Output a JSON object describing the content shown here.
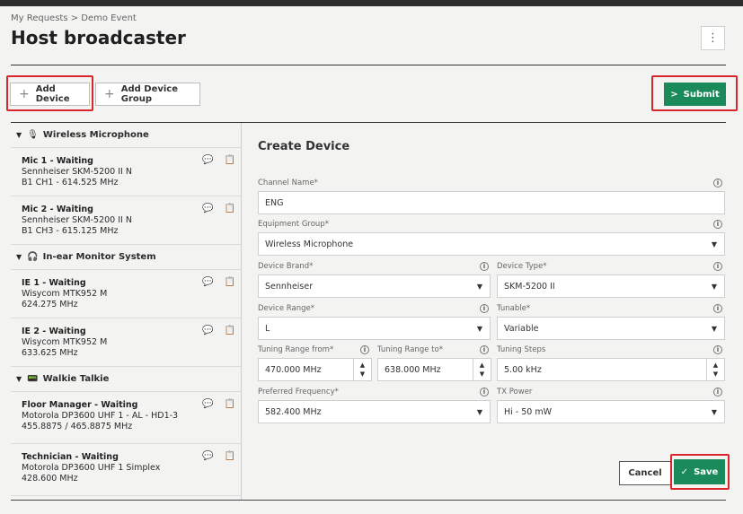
{
  "breadcrumb": "My Requests > Demo Event",
  "page_title": "Host broadcaster",
  "menu_icon": "⋮",
  "toolbar": {
    "add_device": "Add Device",
    "add_device_group": "Add Device Group",
    "submit": "Submit"
  },
  "groups": [
    {
      "label": "Wireless Microphone",
      "icon": "microphone-icon",
      "items": [
        {
          "name": "Mic 1 - Waiting",
          "model": "Sennheiser SKM-5200 II N",
          "freq": "B1 CH1 - 614.525 MHz"
        },
        {
          "name": "Mic 2 - Waiting",
          "model": "Sennheiser SKM-5200 II N",
          "freq": "B1 CH3 - 615.125 MHz"
        }
      ]
    },
    {
      "label": "In-ear Monitor System",
      "icon": "in-ear-icon",
      "items": [
        {
          "name": "IE 1 - Waiting",
          "model": "Wisycom MTK952 M",
          "freq": "624.275 MHz"
        },
        {
          "name": "IE 2 - Waiting",
          "model": "Wisycom MTK952 M",
          "freq": "633.625 MHz"
        }
      ]
    },
    {
      "label": "Walkie Talkie",
      "icon": "walkie-talkie-icon",
      "items": [
        {
          "name": "Floor Manager - Waiting",
          "model": "Motorola DP3600 UHF 1 - AL - HD1-3",
          "freq": "455.8875 / 465.8875 MHz"
        },
        {
          "name": "Technician - Waiting",
          "model": "Motorola DP3600 UHF 1 Simplex",
          "freq": "428.600 MHz"
        }
      ]
    }
  ],
  "form": {
    "title": "Create Device",
    "channel_name": {
      "label": "Channel Name*",
      "value": "ENG"
    },
    "equipment_group": {
      "label": "Equipment Group*",
      "value": "Wireless Microphone"
    },
    "device_brand": {
      "label": "Device Brand*",
      "value": "Sennheiser"
    },
    "device_type": {
      "label": "Device Type*",
      "value": "SKM-5200 II"
    },
    "device_range": {
      "label": "Device Range*",
      "value": "L"
    },
    "tunable": {
      "label": "Tunable*",
      "value": "Variable"
    },
    "tuning_from": {
      "label": "Tuning Range from*",
      "value": "470.000 MHz"
    },
    "tuning_to": {
      "label": "Tuning Range to*",
      "value": "638.000 MHz"
    },
    "tuning_steps": {
      "label": "Tuning Steps",
      "value": "5.00 kHz"
    },
    "preferred_frequency": {
      "label": "Preferred Frequency*",
      "value": "582.400 MHz"
    },
    "tx_power": {
      "label": "TX Power",
      "value": "Hi - 50 mW"
    },
    "cancel": "Cancel",
    "save": "Save"
  },
  "colors": {
    "accent": "#1b8a5a",
    "highlight": "#d9262c"
  }
}
